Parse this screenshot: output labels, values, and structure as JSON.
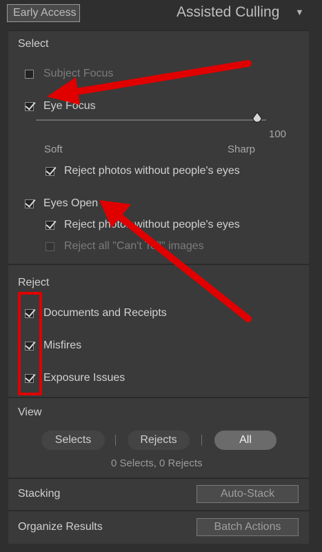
{
  "header": {
    "early_access_label": "Early Access",
    "title": "Assisted Culling"
  },
  "select": {
    "title": "Select",
    "subject_focus": "Subject Focus",
    "eye_focus": "Eye Focus",
    "slider": {
      "value": 100,
      "fraction": 1.0,
      "min_label": "Soft",
      "max_label": "Sharp",
      "value_label": "100"
    },
    "eye_focus_reject": "Reject photos without people's eyes",
    "eyes_open": "Eyes Open",
    "eyes_open_reject": "Reject photos without people's eyes",
    "cant_tell": "Reject all \"Can't Tell\" images"
  },
  "reject": {
    "title": "Reject",
    "items": [
      "Documents and Receipts",
      "Misfires",
      "Exposure Issues"
    ]
  },
  "view": {
    "title": "View",
    "segments": [
      "Selects",
      "Rejects",
      "All"
    ],
    "active": "All",
    "summary": "0 Selects, 0 Rejects"
  },
  "stacking": {
    "title": "Stacking",
    "button": "Auto-Stack"
  },
  "organize": {
    "title": "Organize Results",
    "button": "Batch Actions"
  },
  "colors": {
    "annotation": "#e00000",
    "panel": "#3a3a3a",
    "background": "#2f2f2f"
  }
}
